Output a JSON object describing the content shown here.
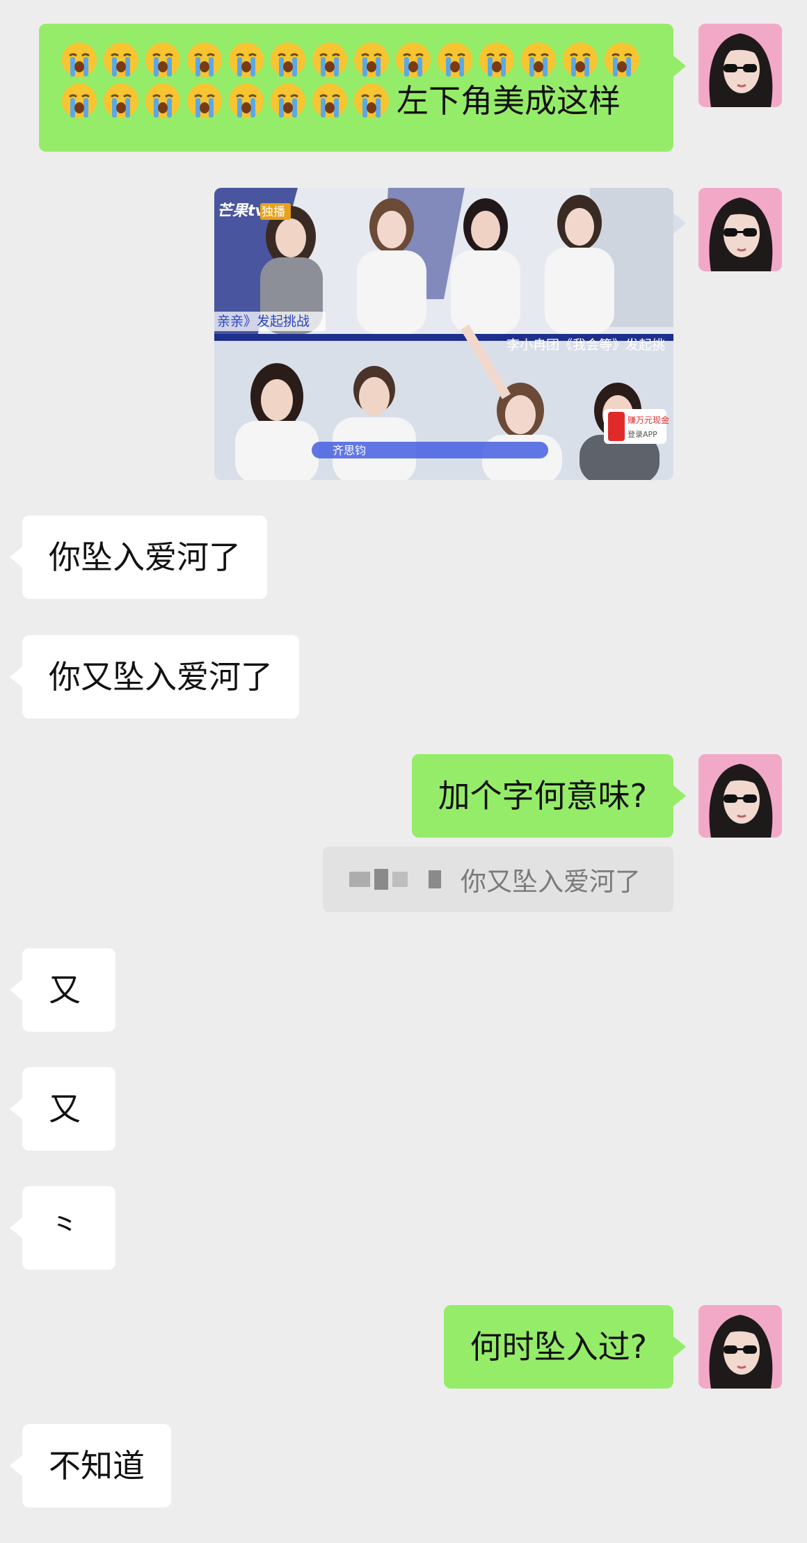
{
  "messages": {
    "m1": {
      "text": "左下角美成这样",
      "emoji": "loudly-crying-face",
      "emoji_count": 22
    },
    "m3": {
      "text": "你坠入爱河了"
    },
    "m4": {
      "text": "你又坠入爱河了"
    },
    "m5": {
      "text": "加个字何意味?"
    },
    "m6": {
      "text": "又"
    },
    "m7": {
      "text": "又"
    },
    "m8": {
      "text": "⺀"
    },
    "m9": {
      "text": "何时坠入过?"
    },
    "m10": {
      "text": "不知道"
    }
  },
  "quote": {
    "text": "你又坠入爱河了"
  },
  "photo": {
    "watermark": "芒果tv",
    "badge": "独播",
    "caption_left": "亲亲》发起挑战",
    "caption_right": "李小冉团《我会等》发起挑",
    "name_tag": "齐思钧",
    "ad_line1": "赚万元现金",
    "ad_line2": "登录APP"
  },
  "colors": {
    "my_bubble": "#95ec69",
    "other_bubble": "#ffffff",
    "background": "#ededed"
  }
}
